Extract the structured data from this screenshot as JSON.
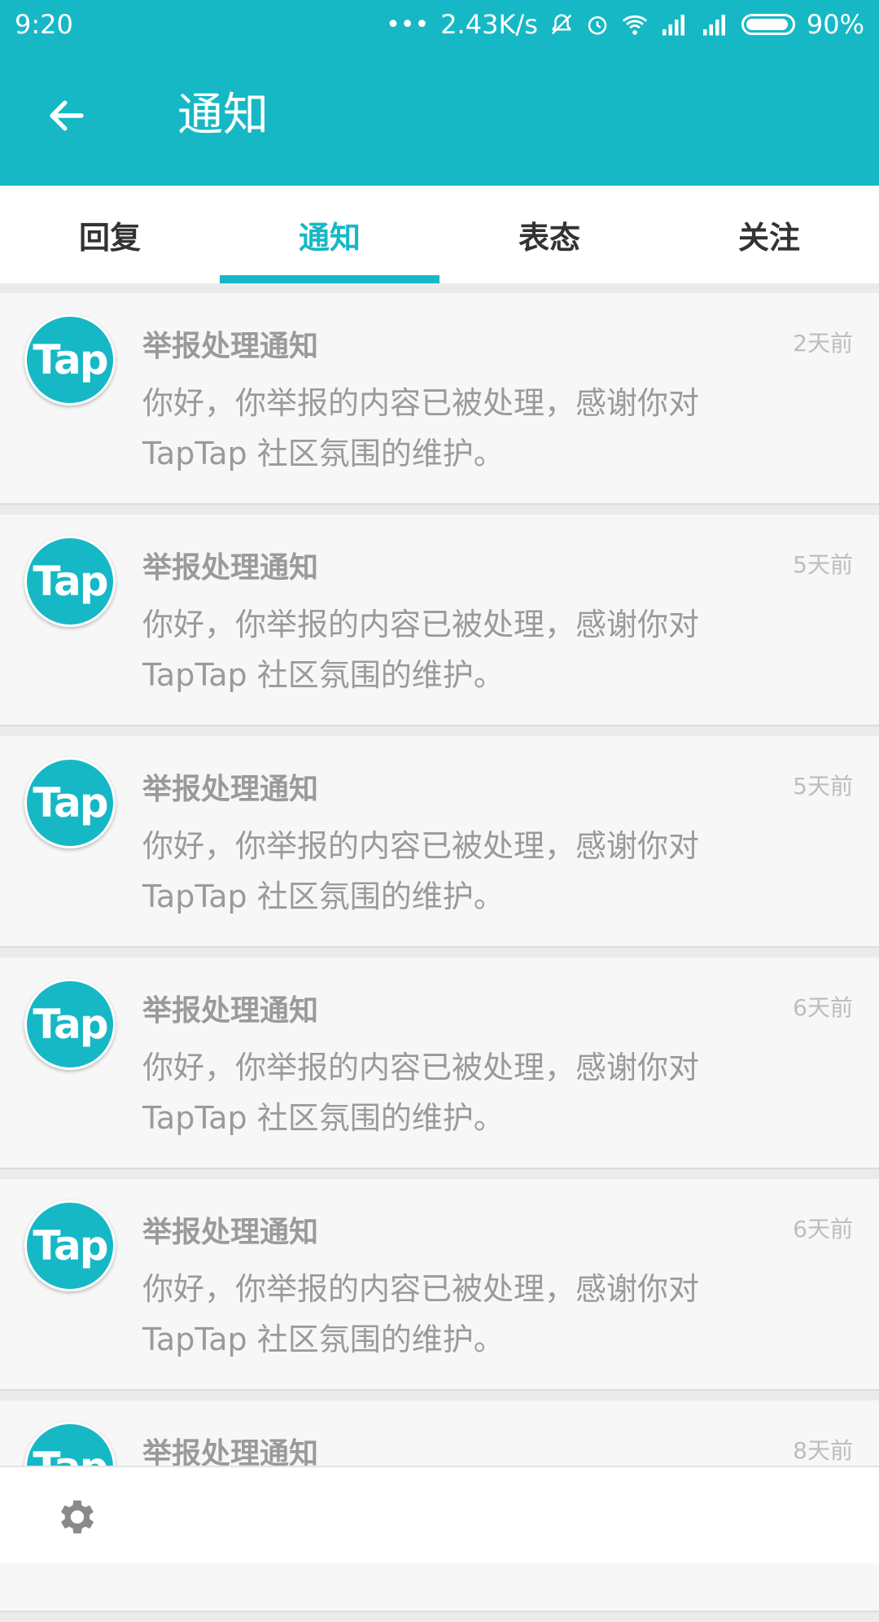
{
  "status_bar": {
    "time": "9:20",
    "speed": "2.43K/s",
    "battery": "90%"
  },
  "app_bar": {
    "title": "通知"
  },
  "tabs": [
    {
      "label": "回复"
    },
    {
      "label": "通知"
    },
    {
      "label": "表态"
    },
    {
      "label": "关注"
    }
  ],
  "notifications": [
    {
      "avatar": "Tap",
      "title": "举报处理通知",
      "time": "2天前",
      "body_line1": "你好，你举报的内容已被处理，感谢你对",
      "body_line2": "TapTap 社区氛围的维护。"
    },
    {
      "avatar": "Tap",
      "title": "举报处理通知",
      "time": "5天前",
      "body_line1": "你好，你举报的内容已被处理，感谢你对",
      "body_line2": "TapTap 社区氛围的维护。"
    },
    {
      "avatar": "Tap",
      "title": "举报处理通知",
      "time": "5天前",
      "body_line1": "你好，你举报的内容已被处理，感谢你对",
      "body_line2": "TapTap 社区氛围的维护。"
    },
    {
      "avatar": "Tap",
      "title": "举报处理通知",
      "time": "6天前",
      "body_line1": "你好，你举报的内容已被处理，感谢你对",
      "body_line2": "TapTap 社区氛围的维护。"
    },
    {
      "avatar": "Tap",
      "title": "举报处理通知",
      "time": "6天前",
      "body_line1": "你好，你举报的内容已被处理，感谢你对",
      "body_line2": "TapTap 社区氛围的维护。"
    },
    {
      "avatar": "Tap",
      "title": "举报处理通知",
      "time": "8天前",
      "body_line1": "",
      "body_line2": ""
    }
  ],
  "colors": {
    "accent": "#16b8c6"
  }
}
